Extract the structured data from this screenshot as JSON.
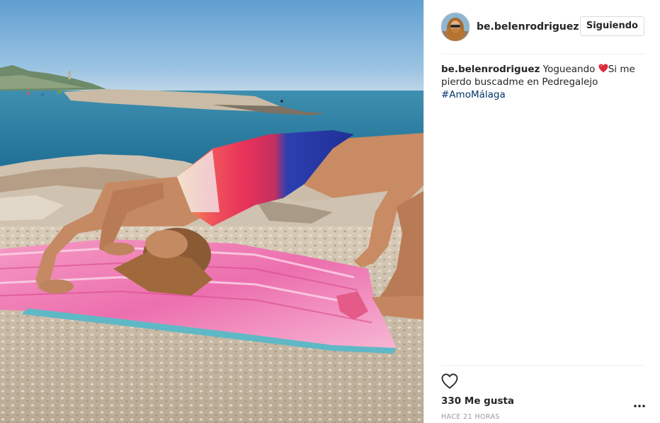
{
  "post": {
    "image_description_icon": "yoga-photo",
    "header": {
      "username": "be.belenrodriguez",
      "follow_button_label": "Siguiendo"
    },
    "caption": {
      "username": "be.belenrodriguez",
      "text_before_emoji": " Yogueando ",
      "emoji": "red-heart-icon",
      "text_after_emoji": "Si me pierdo buscadme en Pedregalejo",
      "hashtag": "#AmoMálaga"
    },
    "actions": {
      "like_icon": "heart-outline-icon",
      "more_icon": "more-options-icon"
    },
    "likes_label": "330 Me gusta",
    "timestamp": "HACE 21 HORAS"
  },
  "colors": {
    "text": "#262626",
    "hashtag": "#003569",
    "muted": "#999999",
    "border": "#dbdbdb",
    "divider": "#efefef"
  }
}
